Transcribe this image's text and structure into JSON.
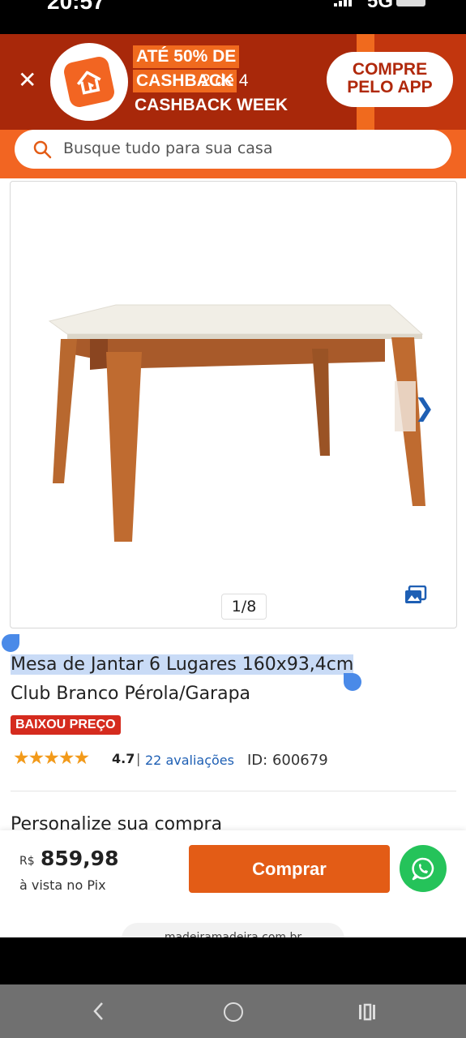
{
  "status_bar": {
    "time": "20:57",
    "network": "5G"
  },
  "promo_banner": {
    "headline_line1": "ATÉ 50% DE",
    "headline_line2": "CASHBACK",
    "pager": "2 de 4",
    "subtitle": "CASHBACK WEEK",
    "app_button_line1": "COMPRE",
    "app_button_line2": "PELO APP"
  },
  "search": {
    "placeholder": "Busque tudo para sua casa"
  },
  "gallery": {
    "counter": "1/8"
  },
  "product": {
    "title_line1": "Mesa de Jantar 6 Lugares 160x93,4cm",
    "title_line2": "Club Branco Pérola/Garapa",
    "badge": "BAIXOU PREÇO",
    "rating": "4.7",
    "rating_stars": 4.7,
    "rating_separator": "|",
    "reviews": "22 avaliações",
    "id": "ID: 600679"
  },
  "customize": {
    "title": "Personalize sua compra"
  },
  "purchase": {
    "currency": "R$",
    "price": "859,98",
    "payment_note": "à vista no Pix",
    "buy_label": "Comprar",
    "domain": "madeiramadeira.com.br"
  },
  "colors": {
    "brand_orange": "#f26522",
    "banner_red": "#a8280a",
    "buy_button": "#e35c16",
    "link_blue": "#1e5fb4",
    "whatsapp_green": "#25c35a",
    "badge_red": "#d52b1e"
  },
  "icons": [
    "close-icon",
    "home-logo-icon",
    "search-icon",
    "chevron-right-icon",
    "photos-icon",
    "star-icon",
    "whatsapp-icon",
    "back-icon",
    "home-icon",
    "recents-icon"
  ]
}
